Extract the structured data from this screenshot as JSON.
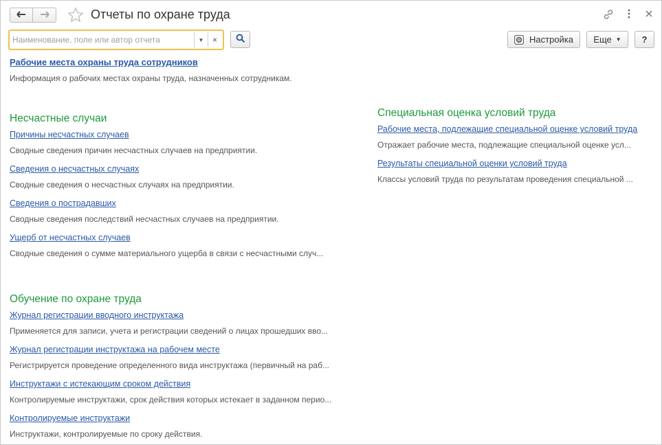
{
  "window": {
    "title": "Отчеты по охране труда"
  },
  "search": {
    "placeholder": "Наименование, поле или автор отчета",
    "value": ""
  },
  "toolbar": {
    "settings_label": "Настройка",
    "more_label": "Еще",
    "help_label": "?"
  },
  "top_report": {
    "link": "Рабочие места охраны труда сотрудников",
    "desc": "Информация о рабочих местах охраны труда, назначенных сотрудникам."
  },
  "sections": {
    "accidents": {
      "title": "Несчастные случаи",
      "items": [
        {
          "link": "Причины несчастных случаев",
          "desc": "Сводные сведения причин несчастных случаев на предприятии."
        },
        {
          "link": "Сведения о несчастных случаях",
          "desc": "Сводные сведения о несчастных случаях на предприятии."
        },
        {
          "link": "Сведения о пострадавших",
          "desc": "Сводные сведения последствий несчастных случаев на предприятии."
        },
        {
          "link": "Ущерб от несчастных случаев",
          "desc": "Сводные сведения о сумме материального ущерба в связи с несчастными случ..."
        }
      ]
    },
    "training": {
      "title": "Обучение по охране труда",
      "items": [
        {
          "link": "Журнал регистрации вводного инструктажа",
          "desc": "Применяется для записи, учета и регистрации сведений о лицах прошедших вво..."
        },
        {
          "link": "Журнал регистрации инструктажа на рабочем месте",
          "desc": "Регистрируется проведение определенного вида инструктажа (первичный на раб..."
        },
        {
          "link": "Инструктажи с истекающим сроком действия",
          "desc": "Контролируемые инструктажи, срок действия которых истекает в заданном перио..."
        },
        {
          "link": "Контролируемые инструктажи",
          "desc": "Инструктажи, контролируемые по сроку действия."
        }
      ]
    },
    "assessment": {
      "title": "Специальная оценка условий труда",
      "items": [
        {
          "link": "Рабочие места, подлежащие специальной оценке условий труда",
          "desc": "Отражает рабочие места, подлежащие специальной оценке усл..."
        },
        {
          "link": "Результаты специальной оценки условий труда",
          "desc": "Классы условий труда по результатам проведения специальной ..."
        }
      ]
    }
  },
  "colors": {
    "section_title": "#1f9a3c",
    "link": "#2b5aa8",
    "search_focus": "#f2c14e"
  }
}
